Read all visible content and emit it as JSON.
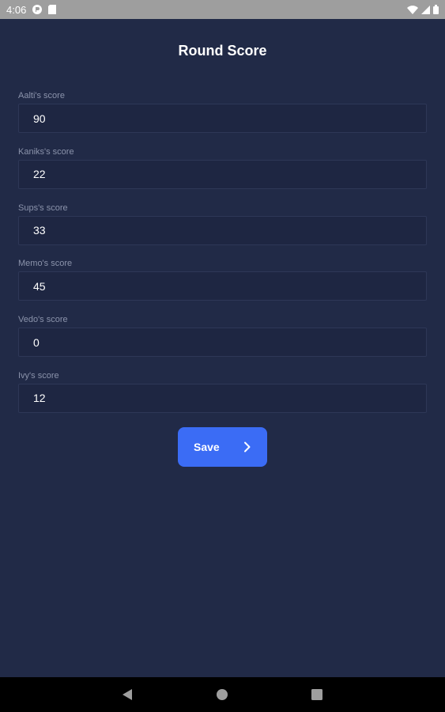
{
  "status_bar": {
    "time": "4:06"
  },
  "screen": {
    "title": "Round Score"
  },
  "fields": [
    {
      "label": "Aalti's score",
      "value": "90"
    },
    {
      "label": "Kaniks's score",
      "value": "22"
    },
    {
      "label": "Sups's score",
      "value": "33"
    },
    {
      "label": "Memo's score",
      "value": "45"
    },
    {
      "label": "Vedo's score",
      "value": "0"
    },
    {
      "label": "Ivy's score",
      "value": "12"
    }
  ],
  "actions": {
    "save_label": "Save"
  },
  "colors": {
    "background": "#212a47",
    "accent": "#3b6cf5",
    "status_bar": "#9e9e9e",
    "nav_bar": "#000000"
  }
}
